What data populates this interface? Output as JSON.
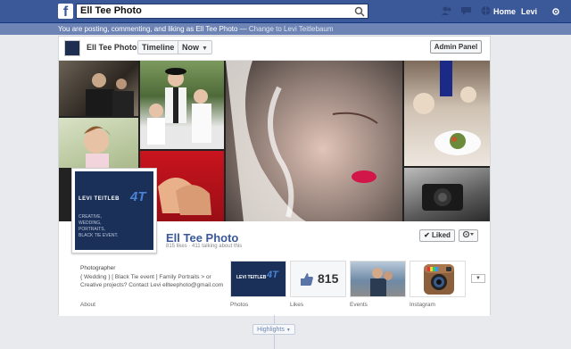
{
  "topbar": {
    "logo": "f",
    "search_value": "Ell Tee Photo",
    "home_label": "Home",
    "user_label": "Levi"
  },
  "notice": {
    "text": "You are posting, commenting, and liking as Ell Tee Photo — ",
    "link": "Change to Levi Teitlebaum"
  },
  "toolbar": {
    "page_name": "Ell Tee Photo",
    "timeline_label": "Timeline",
    "now_label": "Now",
    "admin_label": "Admin Panel"
  },
  "profile": {
    "logo_text": "LEVI TEITLEB",
    "logo_mark": "4T",
    "logo_lines": "CREATIVE,\nWEDDING,\nPORTRAITS,\nBLACK TIE EVENT."
  },
  "page": {
    "name": "Ell Tee Photo",
    "stats": "815 likes · 411 talking about this",
    "liked_label": "Liked",
    "liked_check": "✔"
  },
  "about": {
    "category": "Photographer",
    "description": "{ Wedding } [ Black Tie event ] Family Portraits > or Creative projects? Contact Levi ellteephoto@gmail.com",
    "tab_label": "About"
  },
  "apps": [
    {
      "label": "Photos"
    },
    {
      "label": "Likes",
      "count": "815"
    },
    {
      "label": "Events"
    },
    {
      "label": "Instagram"
    }
  ],
  "highlights_label": "Highlights",
  "colors": {
    "facebook_blue": "#3b5998",
    "notice_bg": "#6d84b4",
    "page_bg": "#e9eaed",
    "logo_navy": "#1b3058"
  }
}
